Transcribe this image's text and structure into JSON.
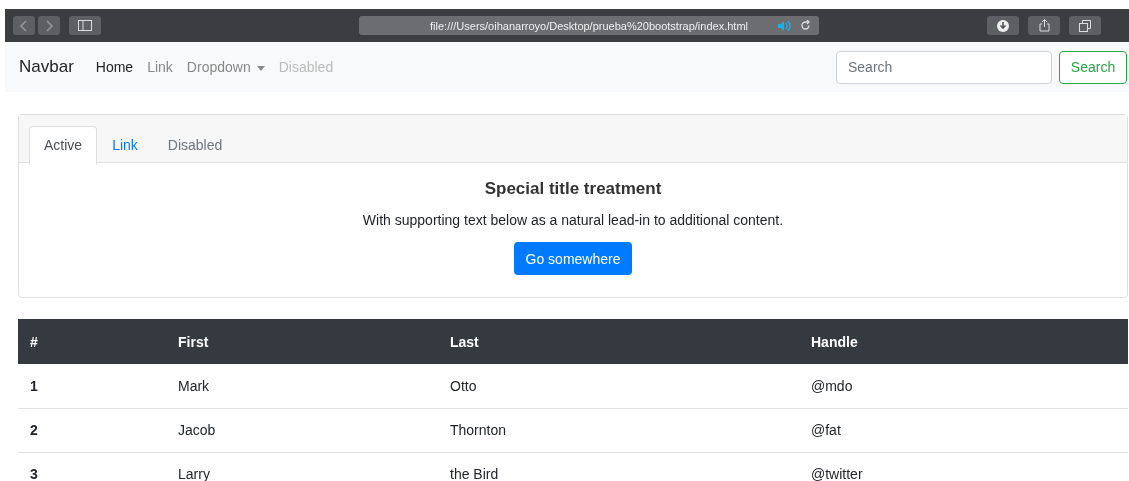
{
  "browser": {
    "address": "file:///Users/oihanarroyo/Desktop/prueba%20bootstrap/index.html"
  },
  "navbar": {
    "brand": "Navbar",
    "items": [
      {
        "label": "Home",
        "active": true,
        "disabled": false,
        "dropdown": false
      },
      {
        "label": "Link",
        "active": false,
        "disabled": false,
        "dropdown": false
      },
      {
        "label": "Dropdown",
        "active": false,
        "disabled": false,
        "dropdown": true
      },
      {
        "label": "Disabled",
        "active": false,
        "disabled": true,
        "dropdown": false
      }
    ],
    "search": {
      "placeholder": "Search"
    },
    "search_button": "Search"
  },
  "card": {
    "tabs": [
      {
        "label": "Active",
        "selected": true,
        "disabled": false
      },
      {
        "label": "Link",
        "selected": false,
        "disabled": false
      },
      {
        "label": "Disabled",
        "selected": false,
        "disabled": true
      }
    ],
    "title": "Special title treatment",
    "text": "With supporting text below as a natural lead-in to additional content.",
    "button": "Go somewhere"
  },
  "table": {
    "columns": [
      "#",
      "First",
      "Last",
      "Handle"
    ],
    "rows": [
      [
        "1",
        "Mark",
        "Otto",
        "@mdo"
      ],
      [
        "2",
        "Jacob",
        "Thornton",
        "@fat"
      ],
      [
        "3",
        "Larry",
        "the Bird",
        "@twitter"
      ]
    ]
  }
}
